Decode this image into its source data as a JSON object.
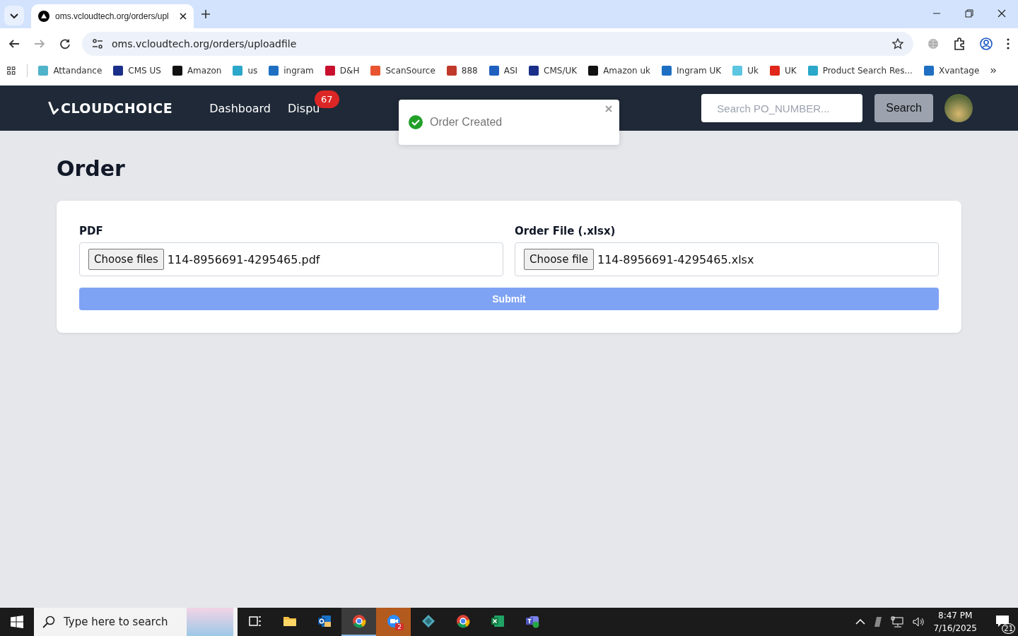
{
  "browser": {
    "tab": {
      "title": "oms.vcloudtech.org/orders/upl",
      "selected": true
    },
    "address": "oms.vcloudtech.org/orders/uploadfile",
    "bookmarks": [
      {
        "label": "Attandance",
        "color": "#4fb3c9"
      },
      {
        "label": "CMS US",
        "color": "#1a2f8a"
      },
      {
        "label": "Amazon",
        "color": "#111111"
      },
      {
        "label": "us",
        "color": "#2aa7c9"
      },
      {
        "label": "ingram",
        "color": "#1e6fc2"
      },
      {
        "label": "D&H",
        "color": "#c8102e"
      },
      {
        "label": "ScanSource",
        "color": "#e8542f"
      },
      {
        "label": "888",
        "color": "#c0392b"
      },
      {
        "label": "ASI",
        "color": "#1f5fbf"
      },
      {
        "label": "CMS/UK",
        "color": "#1a2f8a"
      },
      {
        "label": "Amazon uk",
        "color": "#111111"
      },
      {
        "label": "Ingram UK",
        "color": "#1e6fc2"
      },
      {
        "label": "Uk",
        "color": "#5cc6e0"
      },
      {
        "label": "UK",
        "color": "#e0261b"
      },
      {
        "label": "Product Search Res...",
        "color": "#2aa7c9"
      },
      {
        "label": "Xvantage",
        "color": "#1e6fc2"
      }
    ]
  },
  "app": {
    "logo": "CLOUDCHOICE",
    "nav": [
      {
        "label": "Dashboard"
      },
      {
        "label": "Dispu",
        "badge": "67"
      }
    ],
    "search": {
      "placeholder": "Search PO_NUMBER...",
      "button": "Search"
    }
  },
  "toast": {
    "message": "Order Created"
  },
  "page": {
    "title": "Order",
    "fields": [
      {
        "label": "PDF",
        "button": "Choose files",
        "value": "114-8956691-4295465.pdf"
      },
      {
        "label": "Order File (.xlsx)",
        "button": "Choose file",
        "value": "114-8956691-4295465.xlsx"
      }
    ],
    "submit": {
      "label": "Submit",
      "disabled": true
    }
  },
  "taskbar": {
    "search_placeholder": "Type here to search",
    "apps": [
      {
        "kind": "taskview",
        "selected": false
      },
      {
        "kind": "folder",
        "selected": false
      },
      {
        "kind": "outlook",
        "selected": false
      },
      {
        "kind": "chrome",
        "selected": true
      },
      {
        "kind": "zoom",
        "selected": false,
        "badge": "2"
      },
      {
        "kind": "diamond",
        "selected": false
      },
      {
        "kind": "chrome",
        "selected": false
      },
      {
        "kind": "excel",
        "selected": false
      },
      {
        "kind": "teams",
        "selected": false
      }
    ],
    "time": "8:47 PM",
    "date": "7/16/2025",
    "notifications": "21"
  }
}
